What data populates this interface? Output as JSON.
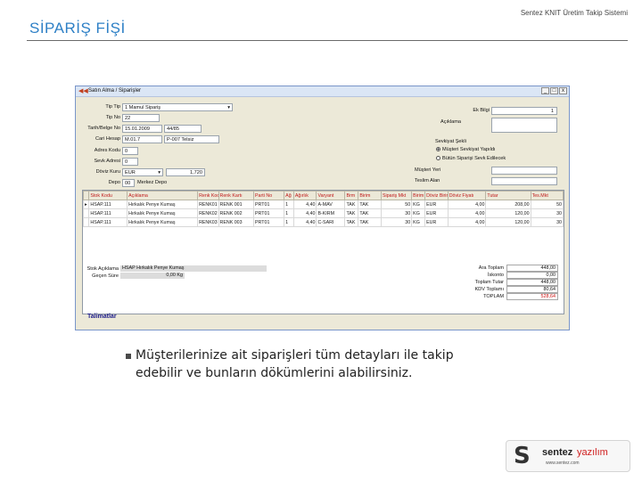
{
  "slide": {
    "title": "SİPARİŞ FİŞİ",
    "subtitle": "Sentez KNIT Üretim Takip Sistemi",
    "bullet": "Müşterilerinize ait siparişleri tüm detayları ile takip edebilir ve bunların dökümlerini alabilirsiniz."
  },
  "window": {
    "title": "Satın Alma / Siparişler",
    "buttons": {
      "minimize": "_",
      "maximize": "□",
      "close": "x"
    }
  },
  "form": {
    "tip_label": "Tip Tip",
    "tip_value": "1 Mamul Sipariş",
    "tip_no_label": "Tip No",
    "tip_no_value": "22",
    "tarih_label": "Tarih/Belge No",
    "tarih_value": "15.01.2009",
    "belge_value": "44/85",
    "cari_label": "Cari Hesap",
    "cari_code": "M.01.7",
    "cari_name": "P-007 Telsiz",
    "adres_label": "Adres Kodu",
    "adres_value": "0",
    "sevk_label": "Sevk Adresi",
    "sevk_value": "0",
    "doviz_label": "Döviz Kuru",
    "doviz_code": "EUR",
    "doviz_rate": "1,720",
    "depo_label": "Depo",
    "depo_code": "00",
    "depo_name": "Merkez Depo",
    "ek_label": "Ek Bilgi",
    "ek_value": "1",
    "aciklama_label": "Açıklama",
    "sevk_sekli_label": "Sevkiyat Şekli",
    "radio1": "Müşteri Sevkiyat Yapıldı",
    "radio2": "Bütün Siparişi Sevk Edilecek",
    "musteri_yeri_label": "Müşteri Yeri",
    "teslim_label": "Teslim Alan"
  },
  "grid": {
    "columns": [
      "Stok Kodu",
      "Açıklama",
      "Renk Kodu",
      "Renk Kartı",
      "Parti No",
      "Ağ",
      "Ağırlık",
      "Varyant",
      "Brm",
      "Birim",
      "Sipariş Mkt",
      "Birim",
      "Döviz Birim",
      "Döviz Fiyatı",
      "Tutar",
      "Tes.Mkt"
    ],
    "rows": [
      [
        "HSAP.111",
        "Hırkalık Penye Kumaş",
        "RENK01",
        "RENK 001",
        "PRT01",
        "1",
        "4,40",
        "A-MAV",
        "TAK",
        "TAK",
        "50",
        "KG",
        "EUR",
        "4,00",
        "208,00",
        "50"
      ],
      [
        "HSAP.111",
        "Hırkalık Penye Kumaş",
        "RENK02",
        "RENK 002",
        "PRT01",
        "1",
        "4,40",
        "B-KIRM",
        "TAK",
        "TAK",
        "30",
        "KG",
        "EUR",
        "4,00",
        "120,00",
        "30"
      ],
      [
        "HSAP.111",
        "Hırkalık Penye Kumaş",
        "RENK03",
        "RENK 003",
        "PRT01",
        "1",
        "4,40",
        "C-SARI",
        "TAK",
        "TAK",
        "30",
        "KG",
        "EUR",
        "4,00",
        "120,00",
        "30"
      ]
    ]
  },
  "footer": {
    "stok_label": "Stok Açıklama",
    "stok_value": "HSAP Hırkalık Penye Kumaş",
    "gecen_label": "Geçen Süre",
    "gecen_value": "0,00 Kg",
    "sums": [
      {
        "label": "Ara Toplam",
        "value": "448,00"
      },
      {
        "label": "İskonto",
        "value": "0,00"
      },
      {
        "label": "Toplam Tutar",
        "value": "448,00"
      },
      {
        "label": "KDV Toplamı",
        "value": "80,64"
      },
      {
        "label": "TOPLAM",
        "value": "528,64"
      }
    ],
    "talimat": "Talimatlar"
  },
  "logo": {
    "mark": "S",
    "brand1": "sentez",
    "brand2": "yazılım",
    "url": "www.sentez.com"
  },
  "colors": {
    "title": "#2e80c6",
    "grid_header": "#c01818",
    "window_bg": "#ece9d8"
  }
}
